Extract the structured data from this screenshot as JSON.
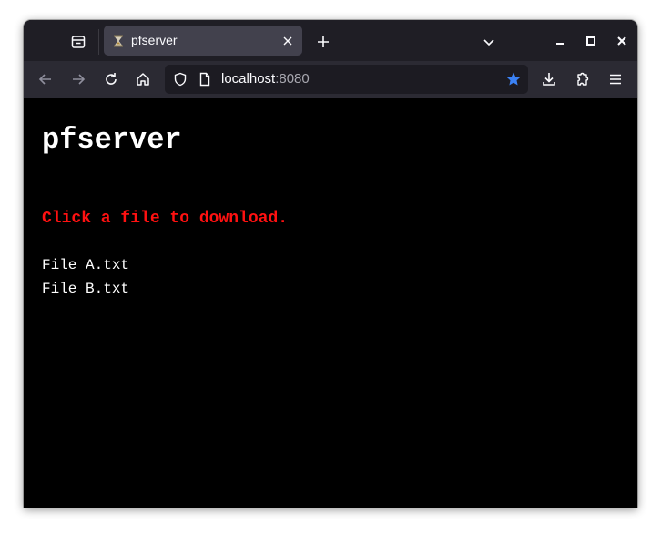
{
  "browser": {
    "tab": {
      "title": "pfserver",
      "favicon": "hourglass-favicon"
    },
    "url": {
      "host": "localhost",
      "port": ":8080"
    },
    "icons": {
      "tab_list": "tab-list-icon",
      "close_tab": "close-icon",
      "new_tab": "plus-icon",
      "list_all_tabs": "chevron-down-icon",
      "minimize": "minimize-icon",
      "maximize": "maximize-icon",
      "close_window": "close-icon",
      "back": "back-arrow-icon",
      "forward": "forward-arrow-icon",
      "reload": "reload-icon",
      "home": "home-icon",
      "tracking_protection": "shield-icon",
      "page_info": "page-icon",
      "bookmark": "star-icon",
      "downloads": "download-icon",
      "extensions": "puzzle-icon",
      "menu": "hamburger-menu-icon"
    },
    "colors": {
      "bookmark_star": "#3b82f6",
      "tab_active": "#42414d",
      "toolbar": "#2b2a33"
    }
  },
  "page": {
    "title": "pfserver",
    "instruction": "Click a file to download.",
    "instruction_color": "#ff1111",
    "files": [
      {
        "name": "File A.txt"
      },
      {
        "name": "File B.txt"
      }
    ]
  }
}
